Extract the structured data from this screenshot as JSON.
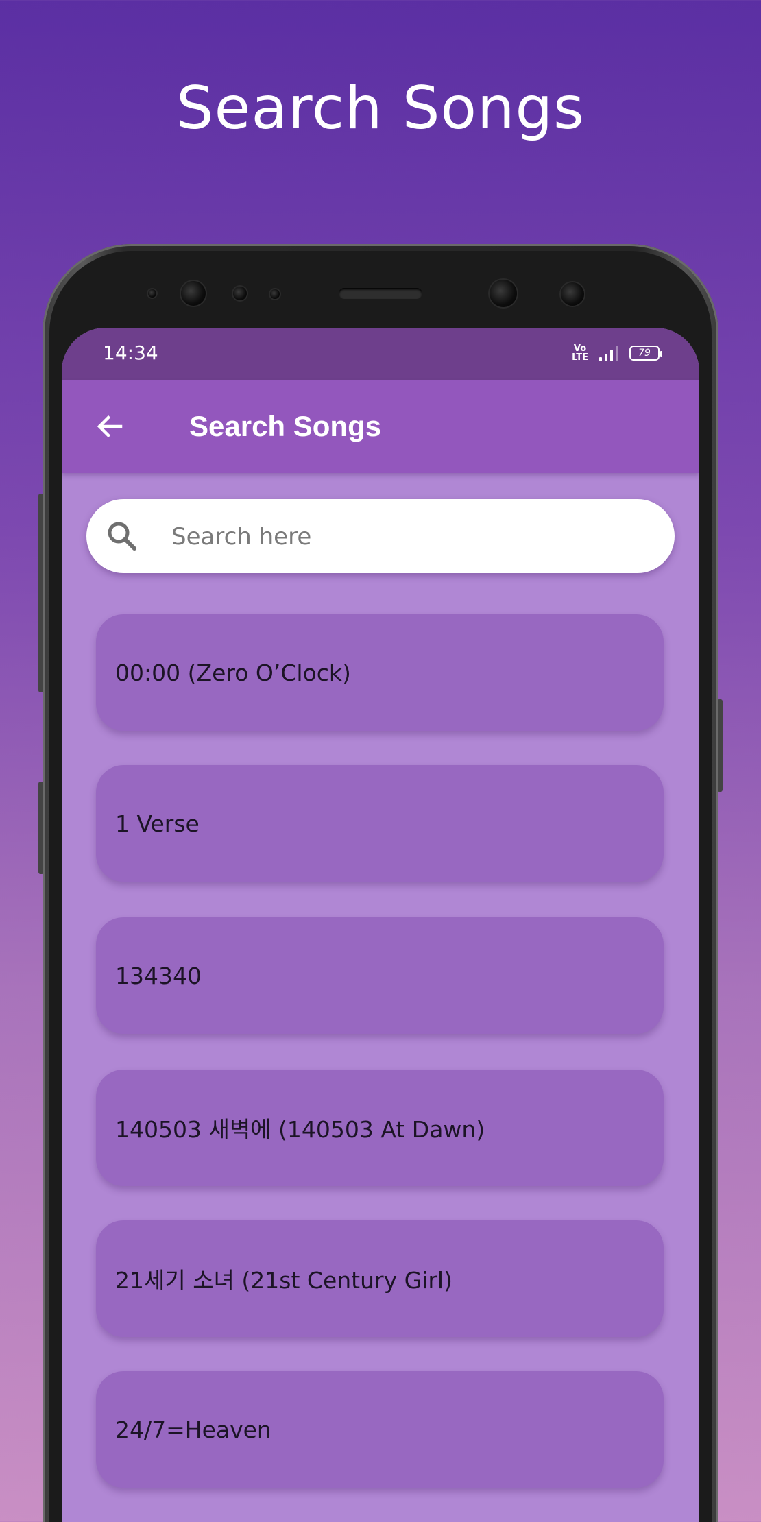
{
  "promo": {
    "title": "Search Songs"
  },
  "status_bar": {
    "time": "14:34",
    "volte_line1": "Vo",
    "volte_line2": "LTE",
    "battery": "79"
  },
  "app_bar": {
    "title": "Search Songs",
    "back_icon": "arrow-left-icon"
  },
  "search": {
    "placeholder": "Search here",
    "value": "",
    "icon": "search-icon"
  },
  "songs": [
    {
      "title": "00:00 (Zero O’Clock)"
    },
    {
      "title": "1 Verse"
    },
    {
      "title": "134340"
    },
    {
      "title": "140503 새벽에 (140503 At Dawn)"
    },
    {
      "title": "21세기 소녀 (21st Century Girl)"
    },
    {
      "title": "24/7=Heaven"
    }
  ],
  "colors": {
    "status_bar": "#6e3f8c",
    "app_bar": "#9357bd",
    "screen_background": "#b087d4",
    "card": "#9868c1"
  }
}
